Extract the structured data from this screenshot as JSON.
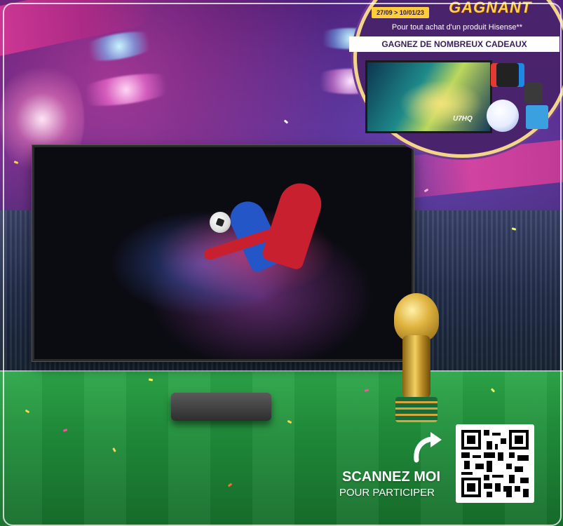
{
  "promo": {
    "headline": "GAGNANT",
    "date_range": "27/09 > 10/01/23",
    "purchase_line": "Pour tout achat d'un produit Hisense**",
    "banner": "GAGNEZ DE NOMBREUX CADEAUX",
    "tv_model_label": "U7HQ"
  },
  "cta": {
    "title": "SCANNEZ MOI",
    "subtitle": "POUR PARTICIPER"
  },
  "icons": [
    "curved-arrow-icon",
    "qr-code-icon",
    "trophy-icon",
    "football-icon"
  ],
  "colors": {
    "accent_pink": "#e545a0",
    "promo_purple": "#4a236d",
    "promo_gold": "#ffcc3a",
    "field_green": "#1f8e3a"
  }
}
